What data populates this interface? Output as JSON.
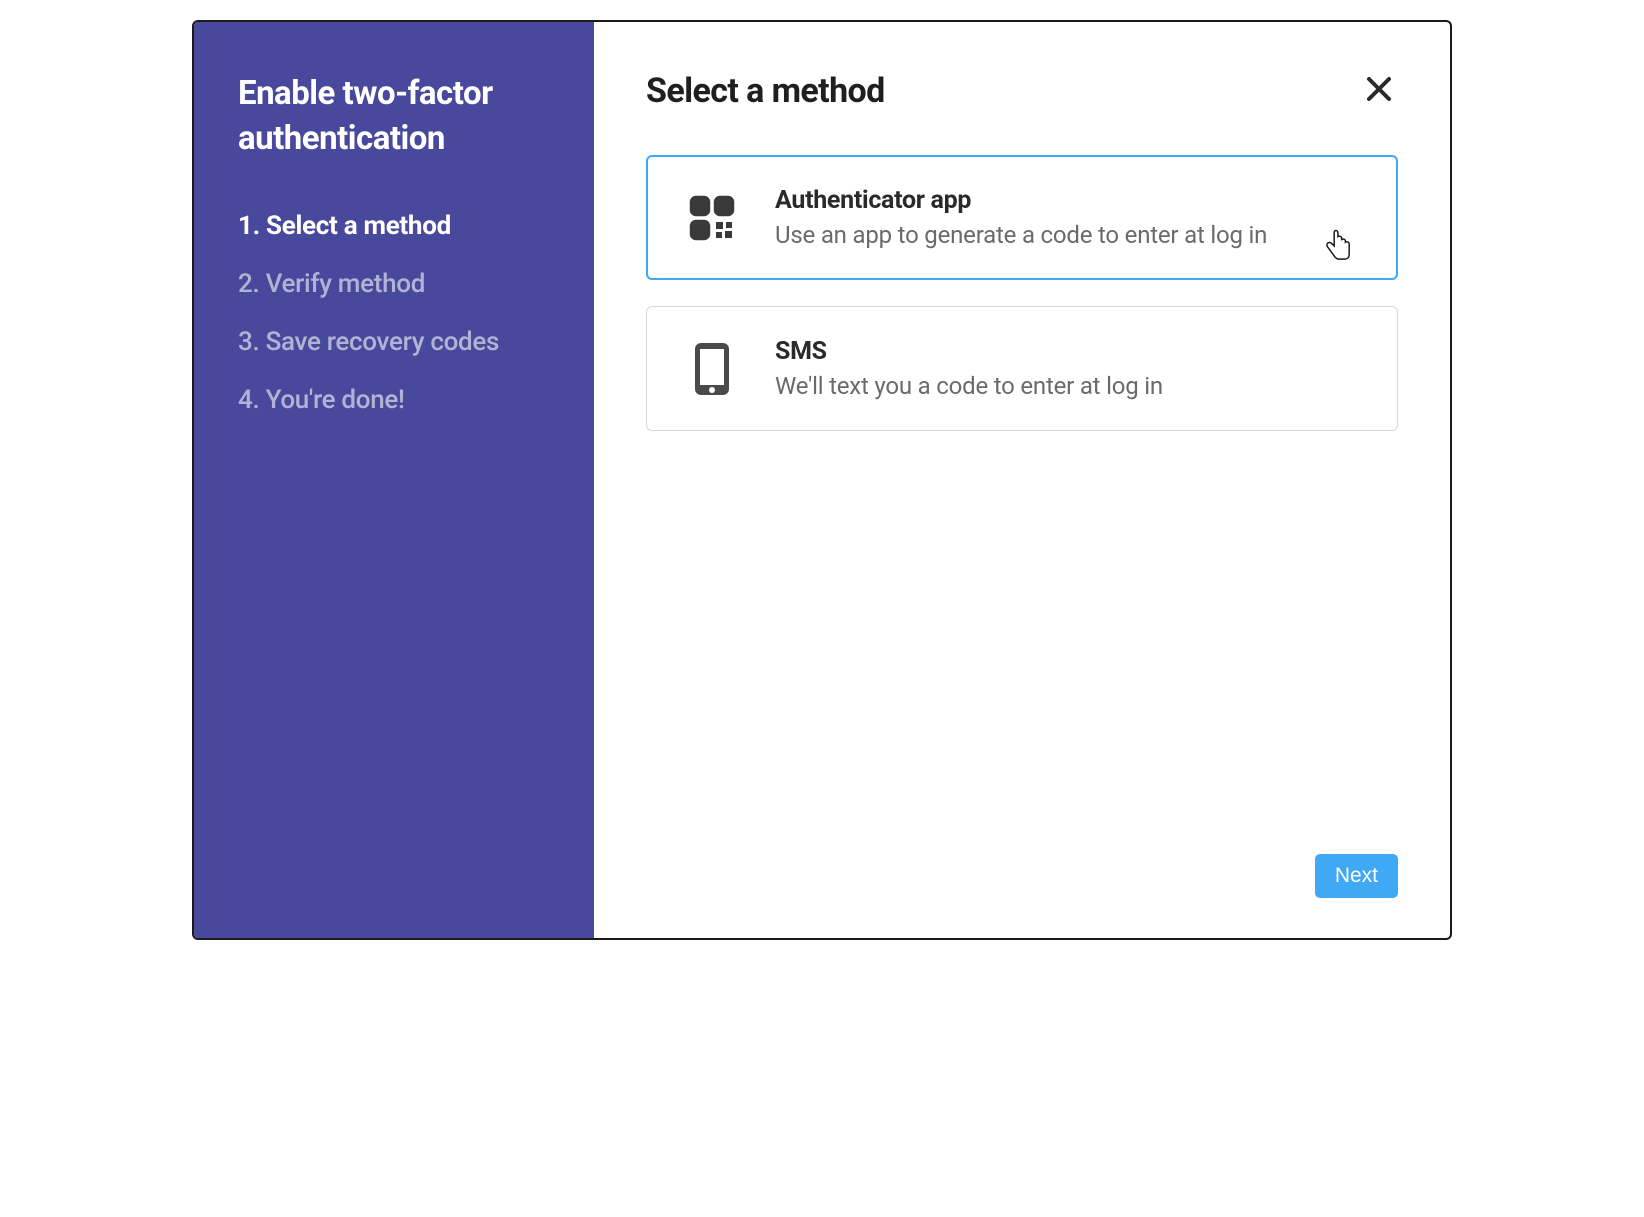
{
  "sidebar": {
    "title": "Enable two-factor authentication",
    "steps": [
      {
        "label": "1. Select a method",
        "active": true
      },
      {
        "label": "2. Verify method",
        "active": false
      },
      {
        "label": "3. Save recovery codes",
        "active": false
      },
      {
        "label": "4. You're done!",
        "active": false
      }
    ]
  },
  "main": {
    "title": "Select a method",
    "options": [
      {
        "id": "authenticator",
        "title": "Authenticator app",
        "description": "Use an app to generate a code to enter at log in",
        "selected": true
      },
      {
        "id": "sms",
        "title": "SMS",
        "description": "We'll text you a code to enter at log in",
        "selected": false
      }
    ],
    "next_label": "Next"
  },
  "colors": {
    "sidebar_bg": "#48489c",
    "accent": "#3fa9f5"
  }
}
